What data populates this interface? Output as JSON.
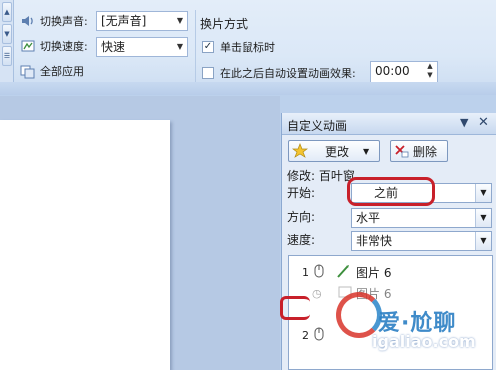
{
  "ribbon": {
    "sound_label": "切换声音:",
    "sound_value": "[无声音]",
    "speed_label": "切换速度:",
    "speed_value": "快速",
    "apply_all_label": "全部应用",
    "advance_group_title": "换片方式",
    "on_click_label": "单击鼠标时",
    "on_click_checked": true,
    "after_label": "在此之后自动设置动画效果:",
    "after_checked": false,
    "after_time": "00:00"
  },
  "pane": {
    "title": "自定义动画",
    "change_button": "更改",
    "delete_button": "删除",
    "modify_label": "修改: 百叶窗",
    "start_label": "开始:",
    "start_value": "之前",
    "direction_label": "方向:",
    "direction_value": "水平",
    "speed_label": "速度:",
    "speed_value": "非常快",
    "list": [
      {
        "number": "1",
        "text": "图片 6"
      },
      {
        "number": "",
        "text": "图片 6"
      },
      {
        "number": "2",
        "text": ""
      }
    ]
  },
  "watermark": {
    "site_name": "爱·尬聊",
    "domain": "igaliao.com"
  },
  "colors": {
    "annotation_red": "#c8202a",
    "ribbon_bg": "#dbe8f7",
    "workspace_bg": "#b6c9e4"
  }
}
